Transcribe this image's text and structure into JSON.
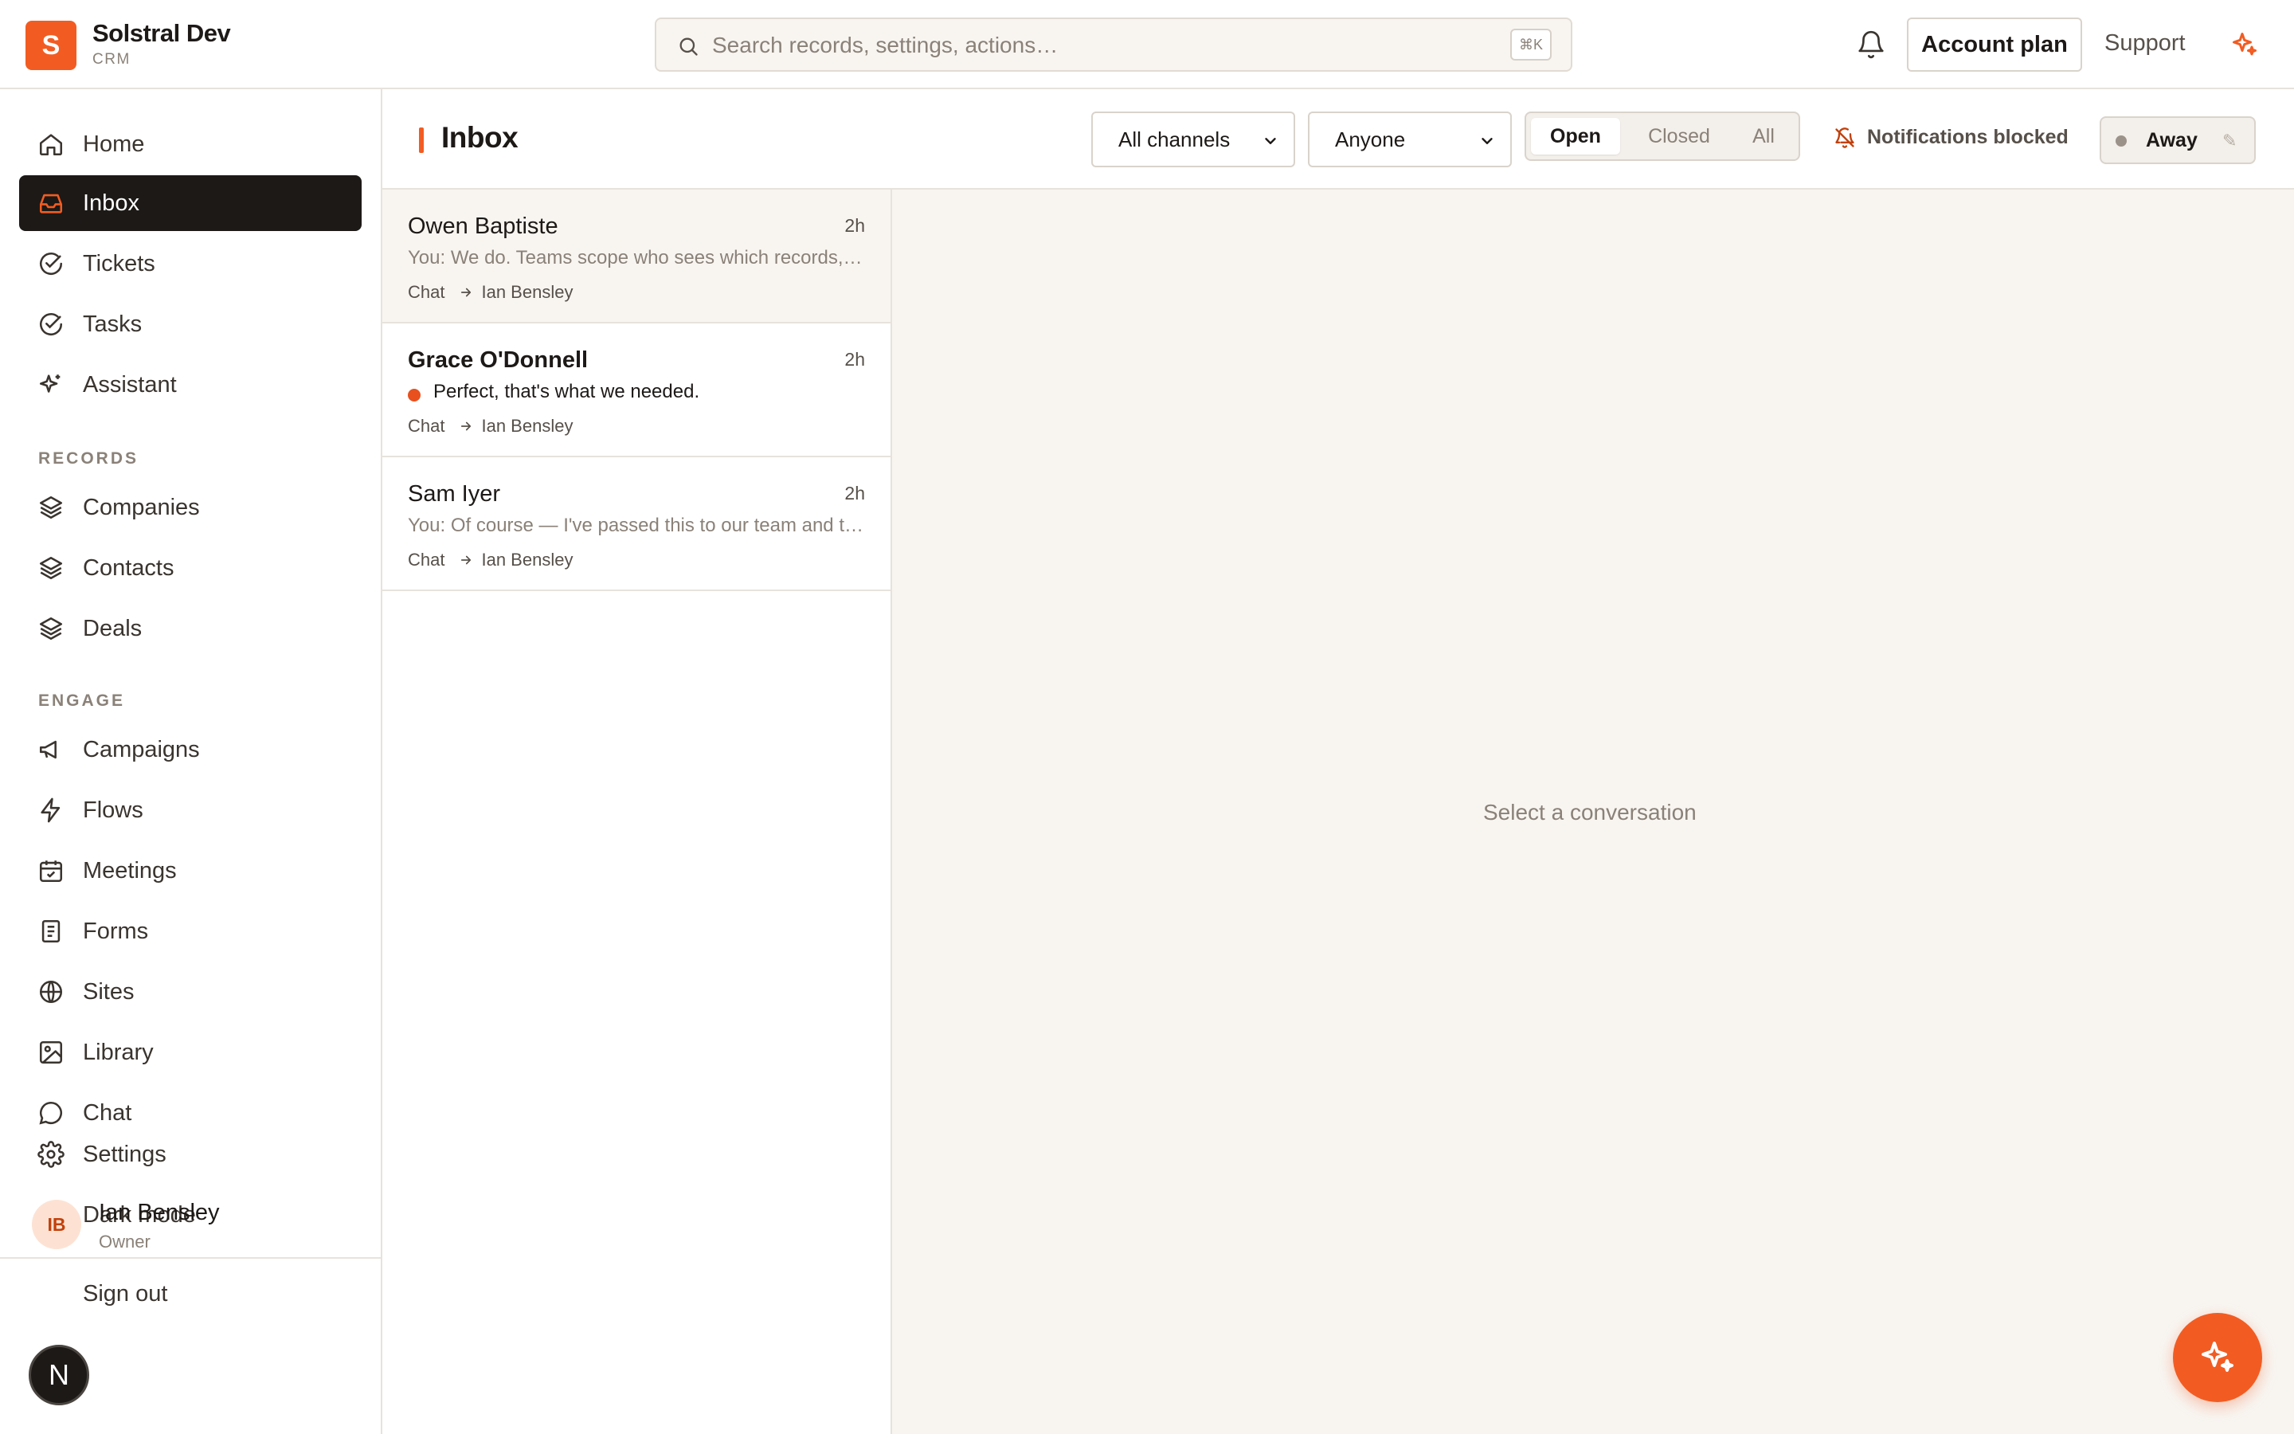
{
  "brand": {
    "logo_letter": "S",
    "name": "Solstral Dev",
    "subtitle": "CRM",
    "accent": "#f25c22"
  },
  "search": {
    "placeholder": "Search records, settings, actions…",
    "shortcut": "⌘K"
  },
  "topbar": {
    "account_label": "Account plan",
    "support_label": "Support"
  },
  "sidebar": {
    "main_items": [
      {
        "label": "Home",
        "icon": "home-icon"
      },
      {
        "label": "Inbox",
        "icon": "inbox-icon",
        "active": true
      },
      {
        "label": "Tickets",
        "icon": "check-circle-icon"
      },
      {
        "label": "Tasks",
        "icon": "check-circle-icon"
      },
      {
        "label": "Assistant",
        "icon": "sparkle-icon"
      }
    ],
    "records_label": "RECORDS",
    "records_items": [
      {
        "label": "Companies",
        "icon": "layers-icon"
      },
      {
        "label": "Contacts",
        "icon": "layers-icon"
      },
      {
        "label": "Deals",
        "icon": "layers-icon"
      }
    ],
    "engage_label": "ENGAGE",
    "engage_items": [
      {
        "label": "Campaigns",
        "icon": "megaphone-icon"
      },
      {
        "label": "Flows",
        "icon": "bolt-icon"
      },
      {
        "label": "Meetings",
        "icon": "calendar-icon"
      },
      {
        "label": "Forms",
        "icon": "form-icon"
      },
      {
        "label": "Sites",
        "icon": "globe-icon"
      },
      {
        "label": "Library",
        "icon": "image-icon"
      },
      {
        "label": "Chat",
        "icon": "chat-icon"
      }
    ],
    "settings_label": "Settings",
    "dark_mode_label": "Dark mode",
    "user": {
      "initials": "IB",
      "name": "Ian Bensley",
      "role": "Owner"
    },
    "sign_out_label": "Sign out",
    "dev_badge": "N"
  },
  "inbox": {
    "title": "Inbox",
    "channel_filter": "All channels",
    "assignee_filter": "Anyone",
    "status_tabs": [
      "Open",
      "Closed",
      "All"
    ],
    "active_status": "Open",
    "notifications_status": "Notifications blocked",
    "presence": "Away",
    "edit_glyph": "✎",
    "conversations": [
      {
        "name": "Owen Baptiste",
        "time": "2h",
        "preview": "You: We do. Teams scope who sees which records, and roles control what they can do.",
        "channel": "Chat",
        "assignee": "Ian Bensley",
        "unread": false
      },
      {
        "name": "Grace O'Donnell",
        "time": "2h",
        "preview": "Perfect, that's what we needed.",
        "channel": "Chat",
        "assignee": "Ian Bensley",
        "unread": true
      },
      {
        "name": "Sam Iyer",
        "time": "2h",
        "preview": "You: Of course — I've passed this to our team and they'll follow up shortly.",
        "channel": "Chat",
        "assignee": "Ian Bensley",
        "unread": false
      }
    ],
    "empty_state": "Select a conversation"
  },
  "colors": {
    "unread_dot": "#e8501e",
    "active_nav_bg": "#1c1917",
    "fab": "#f25c22"
  }
}
